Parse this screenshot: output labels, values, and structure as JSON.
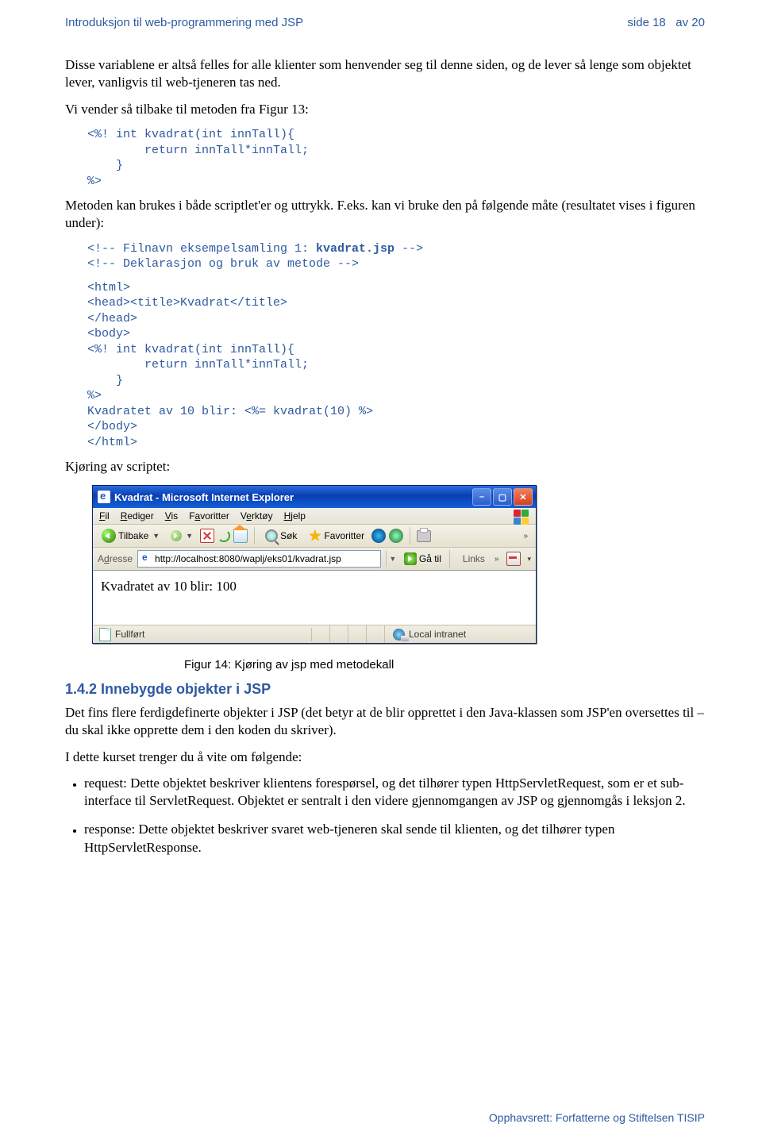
{
  "header": {
    "left": "Introduksjon til web-programmering med JSP",
    "right_side": "side 18",
    "right_av": "av 20"
  },
  "para1": "Disse variablene er altså felles for alle klienter som henvender seg til denne siden, og de lever så lenge som objektet lever, vanligvis til web-tjeneren tas ned.",
  "para2": "Vi vender så tilbake til metoden fra Figur 13:",
  "code1": "<%! int kvadrat(int innTall){\n        return innTall*innTall;\n    }\n%>",
  "para3": "Metoden kan brukes i både scriptlet'er og uttrykk. F.eks. kan vi bruke den på følgende måte (resultatet vises i figuren under):",
  "code2a": "<!-- Filnavn eksempelsamling 1: ",
  "code2b": "kvadrat.jsp",
  "code2c": " -->\n<!-- Deklarasjon og bruk av metode -->",
  "code3": "<html>\n<head><title>Kvadrat</title>\n</head>\n<body>\n<%! int kvadrat(int innTall){\n        return innTall*innTall;\n    }\n%>\nKvadratet av 10 blir: <%= kvadrat(10) %>\n</body>\n</html>",
  "para4": "Kjøring av scriptet:",
  "browser": {
    "title": "Kvadrat - Microsoft Internet Explorer",
    "menu": {
      "file": "Fil",
      "edit": "Rediger",
      "view": "Vis",
      "fav": "Favoritter",
      "tools": "Verktøy",
      "help": "Hjelp"
    },
    "toolbar": {
      "back": "Tilbake",
      "search": "Søk",
      "favorites": "Favoritter"
    },
    "address_label": "Adresse",
    "url": "http://localhost:8080/waplj/eks01/kvadrat.jsp",
    "go": "Gå til",
    "links": "Links",
    "content": "Kvadratet av 10 blir: 100",
    "status_left": "Fullført",
    "status_right": "Local intranet"
  },
  "figcaption": "Figur 14: Kjøring av jsp med metodekall",
  "section_heading": "1.4.2 Innebygde objekter i JSP",
  "para5": "Det fins flere ferdigdefinerte objekter i JSP (det betyr at de blir opprettet i den Java-klassen som JSP'en oversettes til – du skal ikke opprette dem i den koden du skriver).",
  "para6": "I dette kurset trenger du å vite om følgende:",
  "bullet1": "request: Dette objektet beskriver klientens forespørsel, og det tilhører typen HttpServletRequest, som er et sub-interface til ServletRequest. Objektet er sentralt i den videre gjennomgangen av JSP og gjennomgås i leksjon 2.",
  "bullet2": "response: Dette objektet beskriver svaret web-tjeneren skal sende til klienten, og det tilhører typen HttpServletResponse.",
  "footer": "Opphavsrett: Forfatterne og Stiftelsen TISIP"
}
